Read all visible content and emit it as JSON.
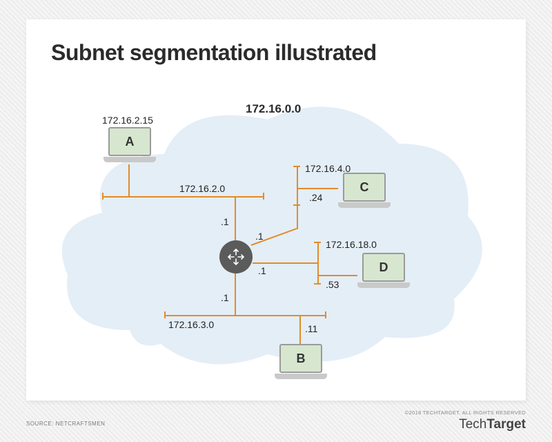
{
  "title": "Subnet segmentation illustrated",
  "network_ip": "172.16.0.0",
  "hosts": {
    "A": {
      "letter": "A",
      "ip": "172.16.2.15"
    },
    "B": {
      "letter": "B"
    },
    "C": {
      "letter": "C"
    },
    "D": {
      "letter": "D"
    }
  },
  "subnets": {
    "s2": {
      "cidr": "172.16.2.0"
    },
    "s3": {
      "cidr": "172.16.3.0"
    },
    "s4": {
      "cidr": "172.16.4.0"
    },
    "s18": {
      "cidr": "172.16.18.0"
    }
  },
  "host_octets": {
    "router_s2": ".1",
    "router_s3": ".1",
    "router_s4": ".1",
    "router_s18": ".1",
    "B": ".11",
    "C": ".24",
    "D": ".53"
  },
  "footer": {
    "source": "SOURCE: NETCRAFTSMEN",
    "copyright": "©2018 TECHTARGET. ALL RIGHTS RESERVED",
    "brand_light": "Tech",
    "brand_bold": "Target"
  }
}
